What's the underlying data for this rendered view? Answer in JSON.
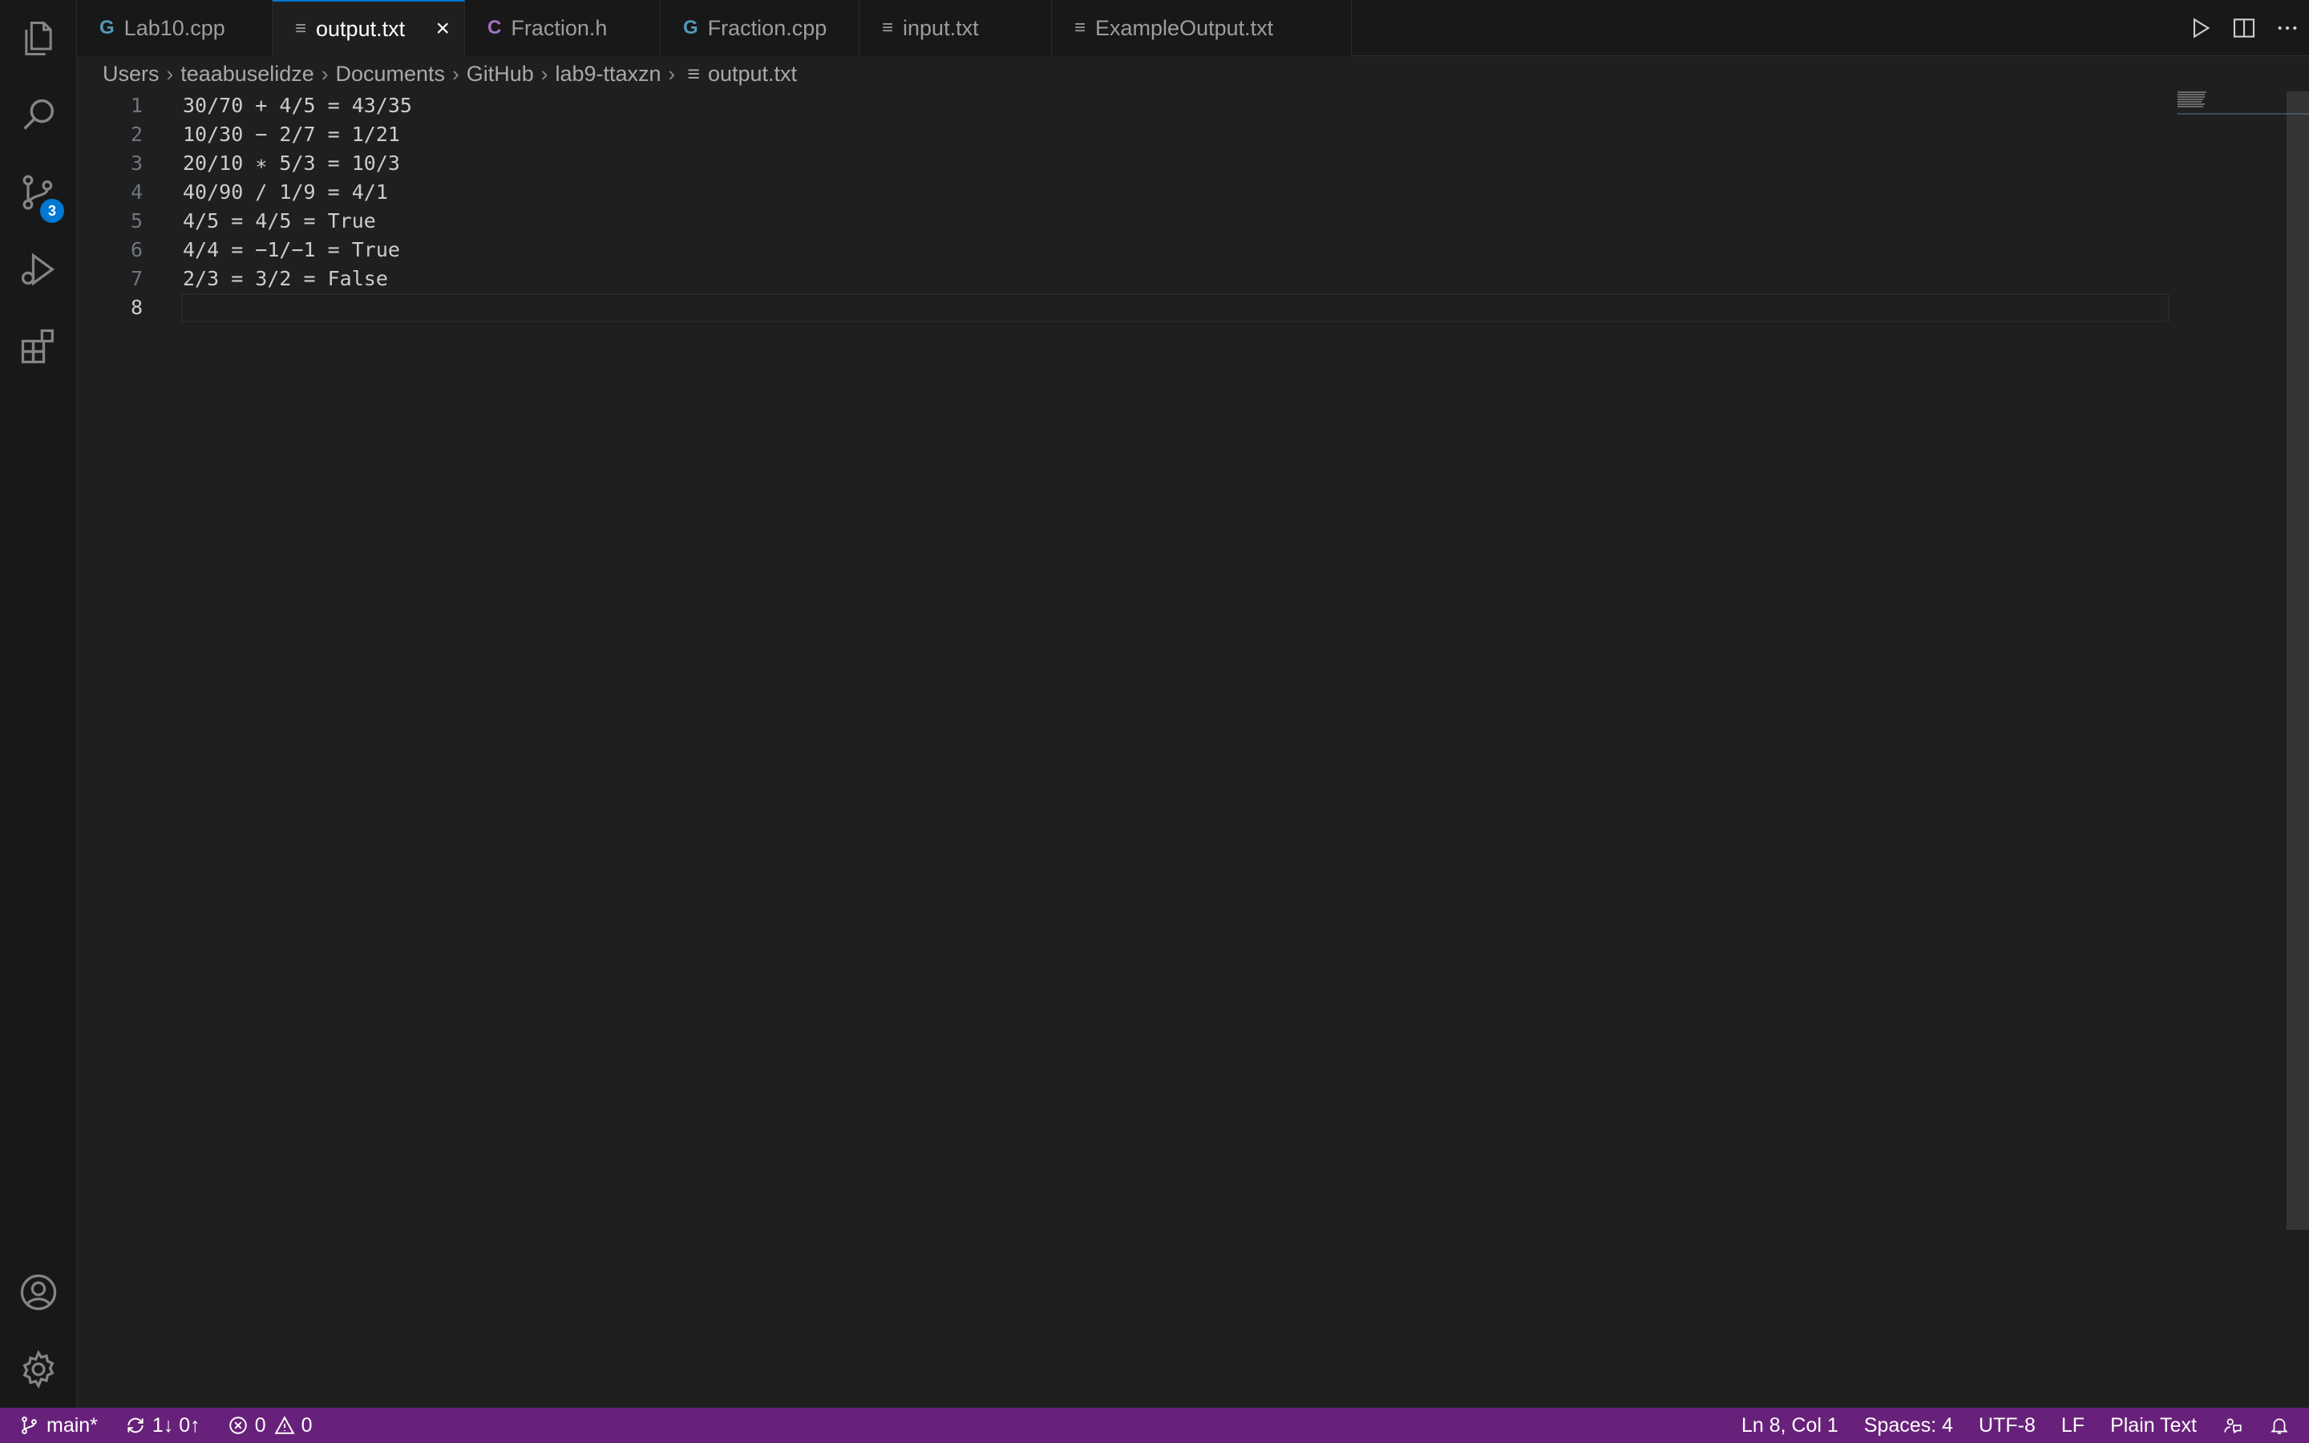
{
  "tabs": [
    {
      "label": "Lab10.cpp",
      "icon": "cpp-file-icon",
      "active": false
    },
    {
      "label": "output.txt",
      "icon": "text-file-icon",
      "active": true
    },
    {
      "label": "Fraction.h",
      "icon": "c-header-file-icon",
      "active": false
    },
    {
      "label": "Fraction.cpp",
      "icon": "cpp-file-icon",
      "active": false
    },
    {
      "label": "input.txt",
      "icon": "text-file-icon",
      "active": false
    },
    {
      "label": "ExampleOutput.txt",
      "icon": "text-file-icon",
      "active": false
    }
  ],
  "breadcrumb": [
    "Users",
    "teaabuselidze",
    "Documents",
    "GitHub",
    "lab9-ttaxzn",
    "output.txt"
  ],
  "activity_bar": {
    "source_control_badge": "3"
  },
  "editor": {
    "lines": [
      {
        "num": "1",
        "text": "30/70 + 4/5 = 43/35"
      },
      {
        "num": "2",
        "text": "10/30 − 2/7 = 1/21"
      },
      {
        "num": "3",
        "text": "20/10 ∗ 5/3 = 10/3"
      },
      {
        "num": "4",
        "text": "40/90 / 1/9 = 4/1"
      },
      {
        "num": "5",
        "text": "4/5 = 4/5 = True"
      },
      {
        "num": "6",
        "text": "4/4 = −1/−1 = True"
      },
      {
        "num": "7",
        "text": "2/3 = 3/2 = False"
      },
      {
        "num": "8",
        "text": ""
      }
    ]
  },
  "status_bar": {
    "branch": "main*",
    "sync": "1↓ 0↑",
    "errors": "0",
    "warnings": "0",
    "position": "Ln 8, Col 1",
    "spaces": "Spaces: 4",
    "encoding": "UTF-8",
    "eol": "LF",
    "language": "Plain Text"
  },
  "colors": {
    "status_bar": "#68217a",
    "accent": "#0078d4",
    "editor_bg": "#1f1f1f"
  }
}
